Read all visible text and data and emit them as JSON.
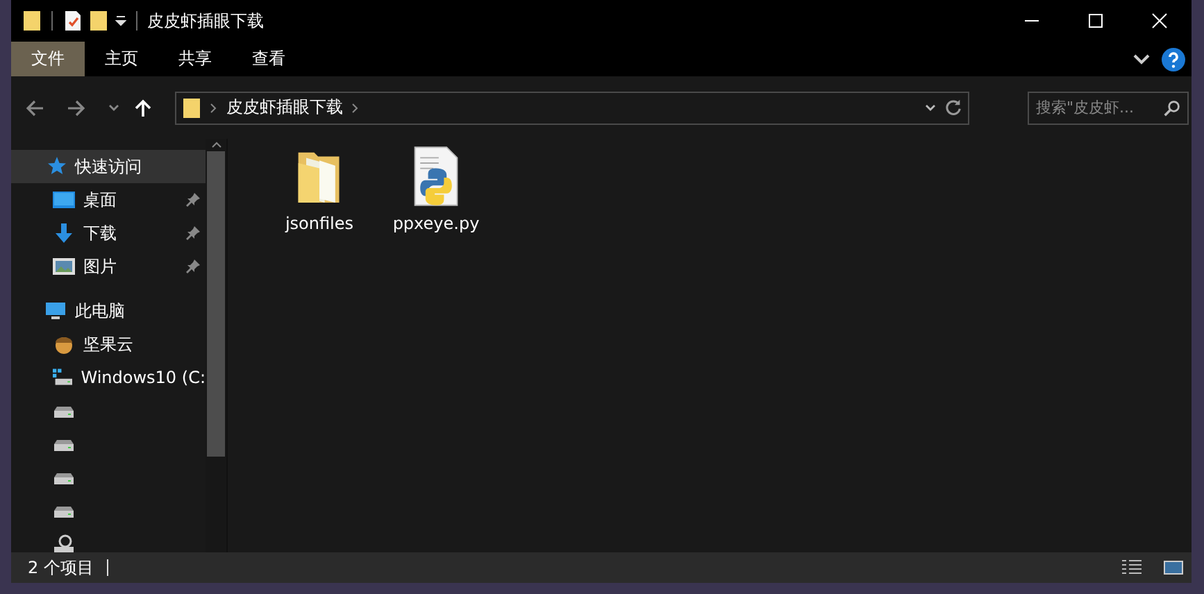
{
  "window": {
    "title": "皮皮虾插眼下载"
  },
  "ribbon_tabs": [
    {
      "label": "文件",
      "selected": true
    },
    {
      "label": "主页",
      "selected": false
    },
    {
      "label": "共享",
      "selected": false
    },
    {
      "label": "查看",
      "selected": false
    }
  ],
  "address_bar": {
    "path": "皮皮虾插眼下载"
  },
  "search": {
    "placeholder": "搜索\"皮皮虾..."
  },
  "sidebar": {
    "items": [
      {
        "label": "快速访问",
        "kind": "star",
        "selected": true,
        "children": [
          {
            "label": "桌面",
            "kind": "desktop",
            "pinned": true,
            "selected": false
          },
          {
            "label": "下载",
            "kind": "download",
            "pinned": true,
            "selected": false
          },
          {
            "label": "图片",
            "kind": "pictures",
            "pinned": true,
            "selected": false
          }
        ]
      },
      {
        "label": "此电脑",
        "kind": "computer",
        "selected": false,
        "children": [
          {
            "label": "坚果云",
            "kind": "nut",
            "selected": false
          },
          {
            "label": "Windows10 (C:",
            "kind": "system-drive",
            "selected": false
          },
          {
            "kind": "drive",
            "selected": false
          },
          {
            "kind": "drive",
            "selected": false
          },
          {
            "kind": "drive",
            "selected": false
          },
          {
            "kind": "drive",
            "selected": false
          },
          {
            "kind": "network",
            "selected": false
          }
        ]
      }
    ]
  },
  "files": [
    {
      "name": "jsonfiles",
      "kind": "folder"
    },
    {
      "name": "ppxeye.py",
      "kind": "python"
    }
  ],
  "status_bar": {
    "count": "2 个项目"
  }
}
